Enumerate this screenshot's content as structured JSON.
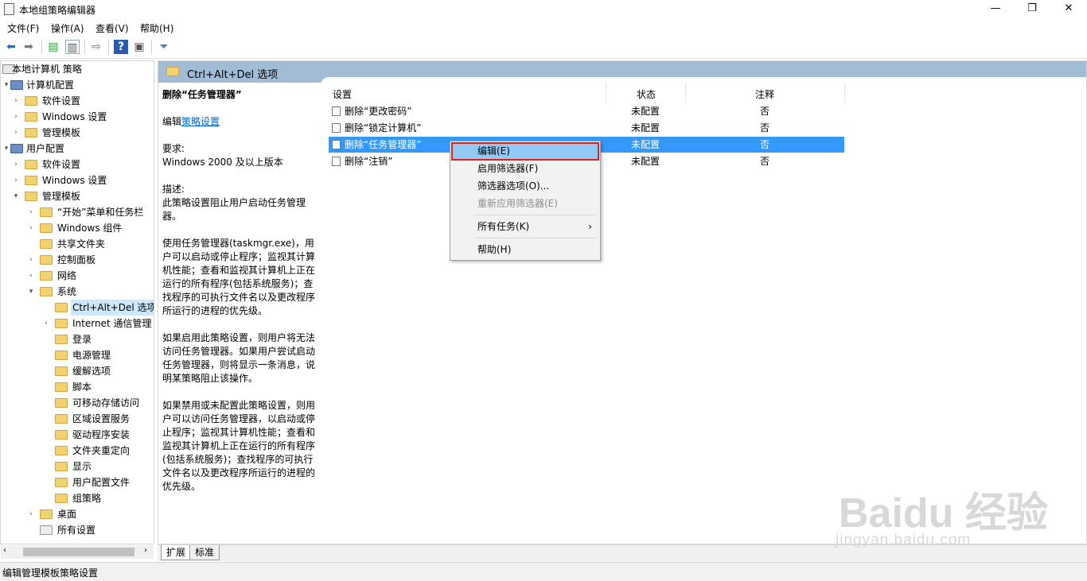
{
  "window": {
    "title": "本地组策略编辑器",
    "minimize": "—",
    "restore": "❐",
    "close": "✕"
  },
  "menu": [
    "文件(F)",
    "操作(A)",
    "查看(V)",
    "帮助(H)"
  ],
  "toolbar": [
    "back-icon",
    "forward-icon",
    "up-folder-icon",
    "show-hide-tree-icon",
    "export-list-icon",
    "help-icon",
    "properties-icon",
    "filter-icon"
  ],
  "tree": {
    "root": "本地计算机 策略",
    "computer": "计算机配置",
    "computer_children": [
      "软件设置",
      "Windows 设置",
      "管理模板"
    ],
    "user": "用户配置",
    "user_children": [
      "软件设置",
      "Windows 设置",
      "管理模板"
    ],
    "admin_children": [
      "“开始”菜单和任务栏",
      "Windows 组件",
      "共享文件夹",
      "控制面板",
      "网络",
      "系统"
    ],
    "system_children": [
      "Ctrl+Alt+Del 选项",
      "Internet 通信管理",
      "登录",
      "电源管理",
      "缓解选项",
      "脚本",
      "可移动存储访问",
      "区域设置服务",
      "驱动程序安装",
      "文件夹重定向",
      "显示",
      "用户配置文件",
      "组策略"
    ],
    "after": [
      "桌面",
      "所有设置"
    ]
  },
  "pane_title": "Ctrl+Alt+Del 选项",
  "description": {
    "title": "删除“任务管理器”",
    "edit_prefix": "编辑",
    "edit_link": "策略设置",
    "req_label": "要求:",
    "req_value": "Windows 2000 及以上版本",
    "desc_label": "描述:",
    "p1": "此策略设置阻止用户启动任务管理器。",
    "p2": "使用任务管理器(taskmgr.exe)，用户可以启动或停止程序；监视其计算机性能；查看和监视其计算机上正在运行的所有程序(包括系统服务)；查找程序的可执行文件名以及更改程序所运行的进程的优先级。",
    "p3": "如果启用此策略设置，则用户将无法访问任务管理器。如果用户尝试启动任务管理器，则将显示一条消息，说明某策略阻止该操作。",
    "p4": "如果禁用或未配置此策略设置，则用户可以访问任务管理器，以启动或停止程序；监视其计算机性能；查看和监视其计算机上正在运行的所有程序(包括系统服务)；查找程序的可执行文件名以及更改程序所运行的进程的优先级。"
  },
  "columns": {
    "setting": "设置",
    "state": "状态",
    "comment": "注释"
  },
  "rows": [
    {
      "name": "删除“更改密码”",
      "state": "未配置",
      "comment": "否"
    },
    {
      "name": "删除“锁定计算机”",
      "state": "未配置",
      "comment": "否"
    },
    {
      "name": "删除“任务管理器”",
      "state": "未配置",
      "comment": "否"
    },
    {
      "name": "删除“注销”",
      "state": "未配置",
      "comment": "否"
    }
  ],
  "context_menu": {
    "edit": "编辑(E)",
    "filter_on": "启用筛选器(F)",
    "filter_options": "筛选器选项(O)...",
    "reapply": "重新应用筛选器(E)",
    "all_tasks": "所有任务(K)",
    "all_tasks_arrow": "›",
    "help": "帮助(H)"
  },
  "tabs": [
    "扩展",
    "标准"
  ],
  "status": "编辑管理模板策略设置",
  "watermark": {
    "brand": "Baidu 经验",
    "url": "jingyan.baidu.com"
  },
  "colors": {
    "selection": "#3399ff",
    "header": "#a3bcd6",
    "menu_highlight": "#91c9f7",
    "highlight_box": "#e02020"
  }
}
